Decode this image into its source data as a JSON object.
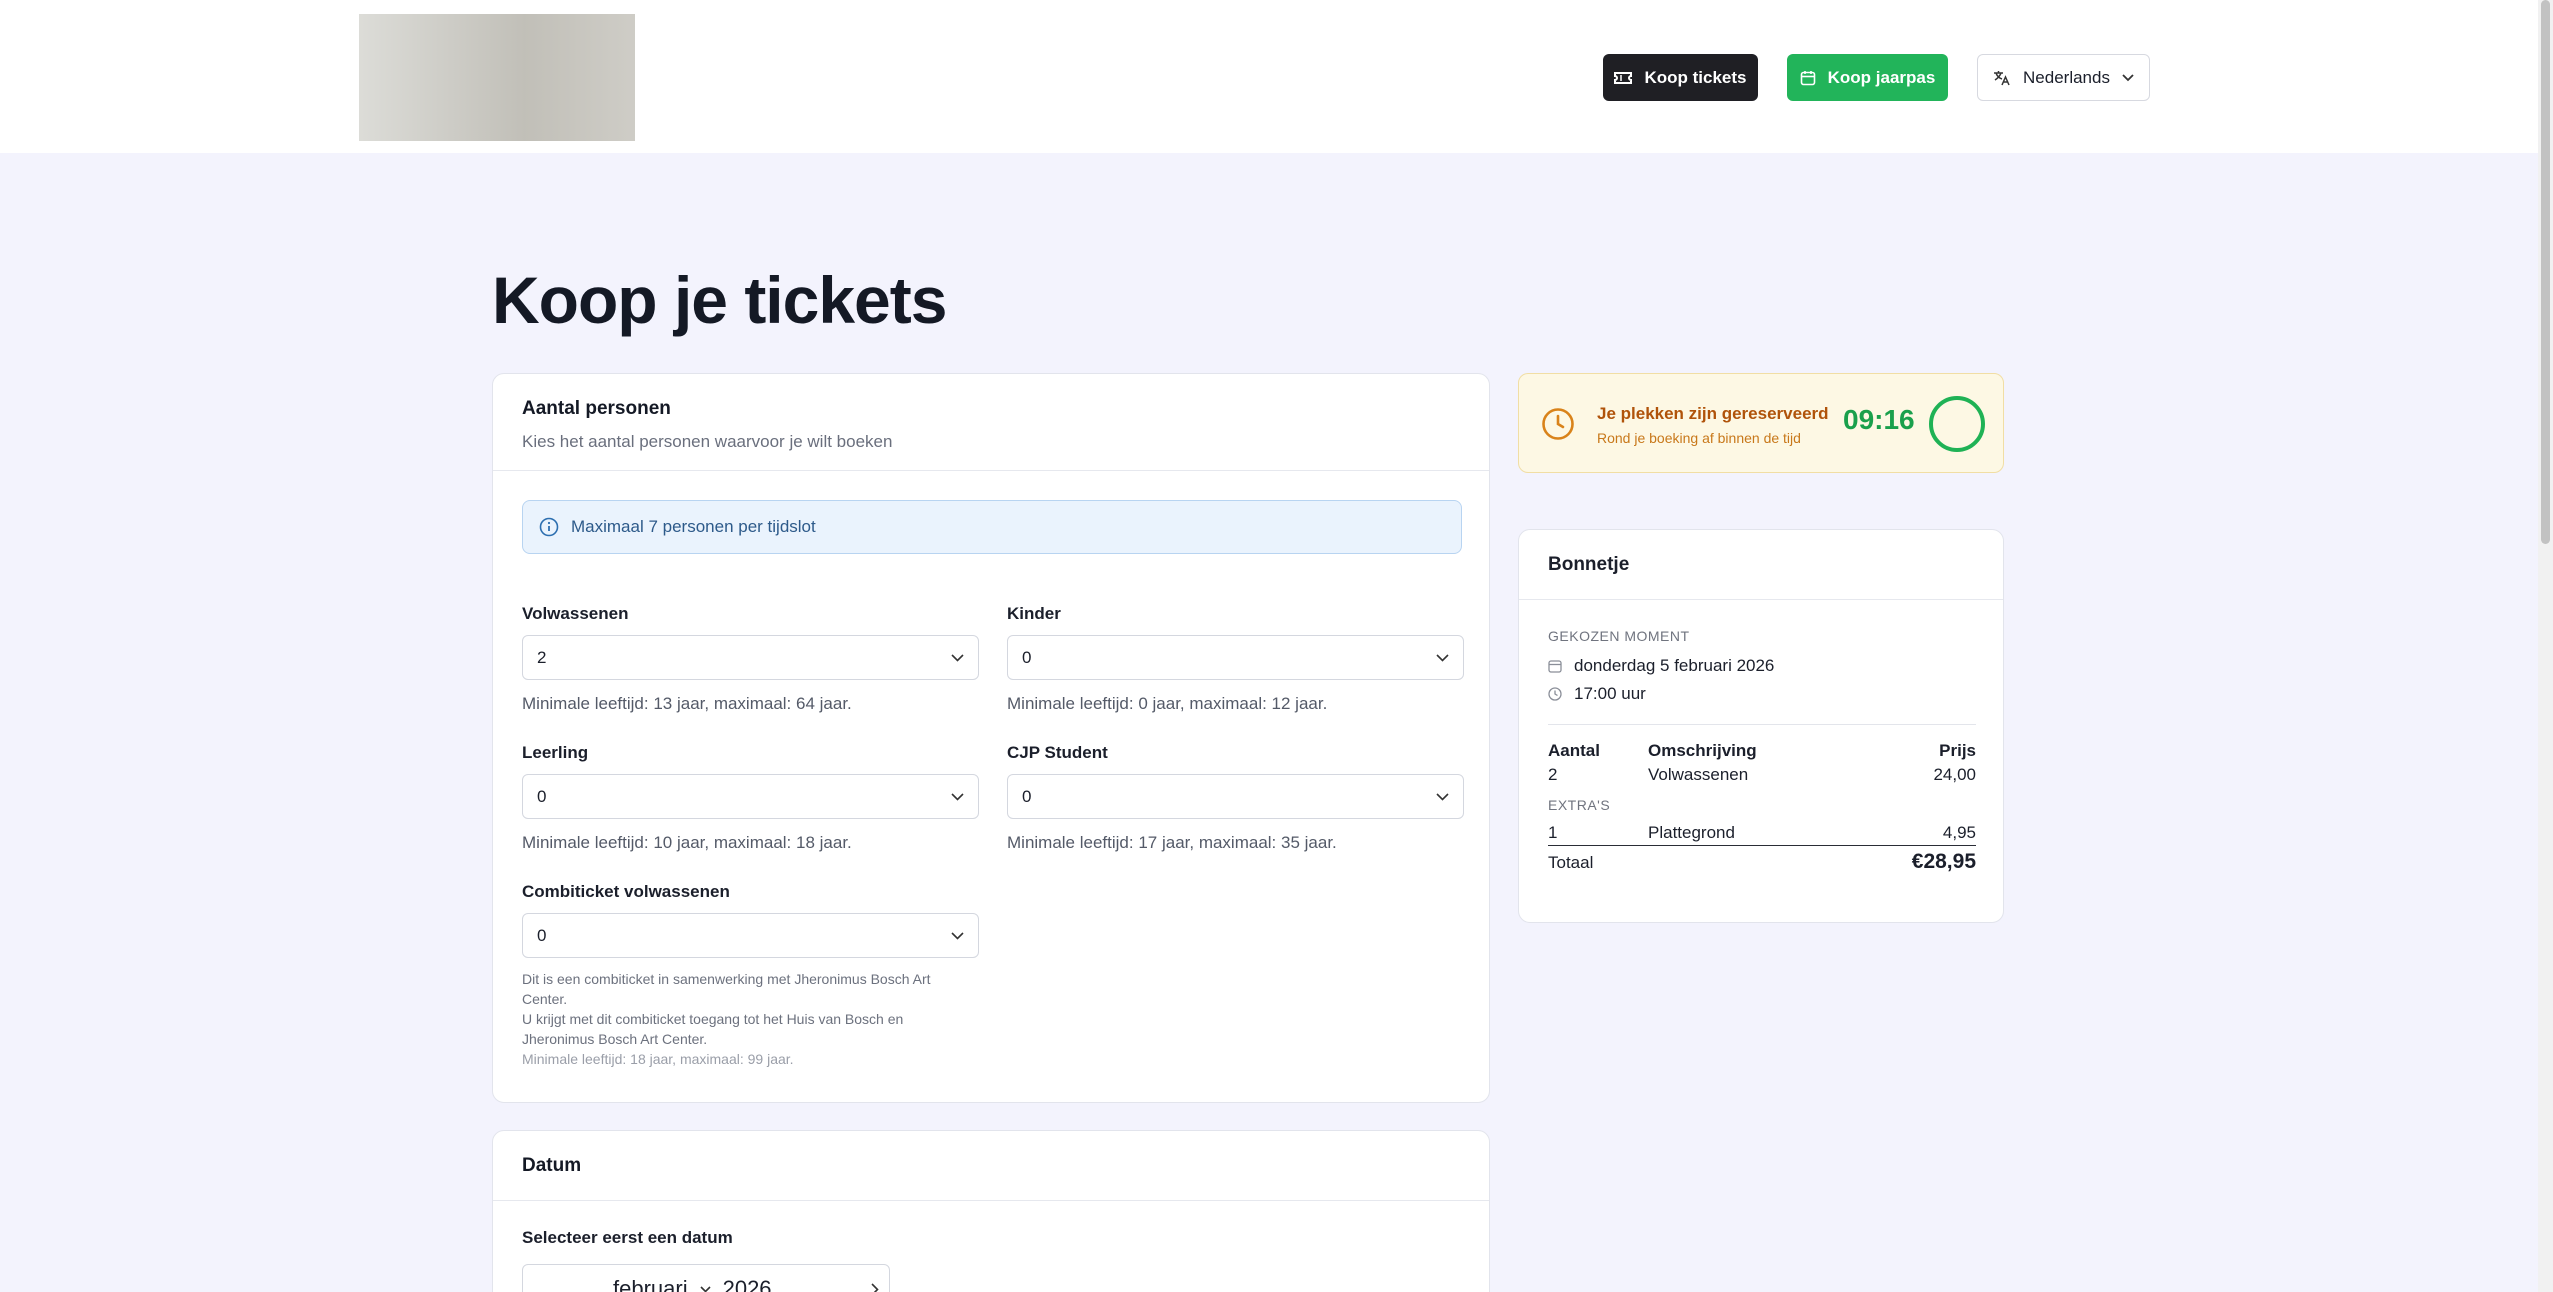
{
  "header": {
    "buy_tickets": "Koop tickets",
    "buy_pass": "Koop jaarpas",
    "language": "Nederlands"
  },
  "page_title": "Koop je tickets",
  "persons": {
    "title": "Aantal personen",
    "subtitle": "Kies het aantal personen waarvoor je wilt boeken",
    "info": "Maximaal 7 personen per tijdslot",
    "fields": [
      {
        "label": "Volwassenen",
        "value": "2",
        "hint": "Minimale leeftijd: 13 jaar, maximaal: 64 jaar."
      },
      {
        "label": "Kinder",
        "value": "0",
        "hint": "Minimale leeftijd: 0 jaar, maximaal: 12 jaar."
      },
      {
        "label": "Leerling",
        "value": "0",
        "hint": "Minimale leeftijd: 10 jaar, maximaal: 18 jaar."
      },
      {
        "label": "CJP Student",
        "value": "0",
        "hint": "Minimale leeftijd: 17 jaar, maximaal: 35 jaar."
      },
      {
        "label": "Combiticket volwassenen",
        "value": "0",
        "note1": "Dit is een combiticket in samenwerking met Jheronimus Bosch Art Center.",
        "note2": "U krijgt met dit combiticket toegang tot het Huis van Bosch en Jheronimus Bosch Art Center.",
        "hint": "Minimale leeftijd: 18 jaar, maximaal: 99 jaar."
      }
    ]
  },
  "timer": {
    "title": "Je plekken zijn gereserveerd",
    "subtitle": "Rond je boeking af binnen de tijd",
    "time": "09:16"
  },
  "receipt": {
    "title": "Bonnetje",
    "moment_caption": "GEKOZEN MOMENT",
    "date": "donderdag 5 februari 2026",
    "time": "17:00 uur",
    "col_qty": "Aantal",
    "col_desc": "Omschrijving",
    "col_price": "Prijs",
    "lines": [
      {
        "qty": "2",
        "desc": "Volwassenen",
        "price": "24,00"
      }
    ],
    "extras_caption": "EXTRA'S",
    "extras": [
      {
        "qty": "1",
        "desc": "Plattegrond",
        "price": "4,95"
      }
    ],
    "total_label": "Totaal",
    "total": "€28,95"
  },
  "date_section": {
    "title": "Datum",
    "prompt": "Selecteer eerst een datum",
    "month": "februari",
    "year": "2026"
  }
}
